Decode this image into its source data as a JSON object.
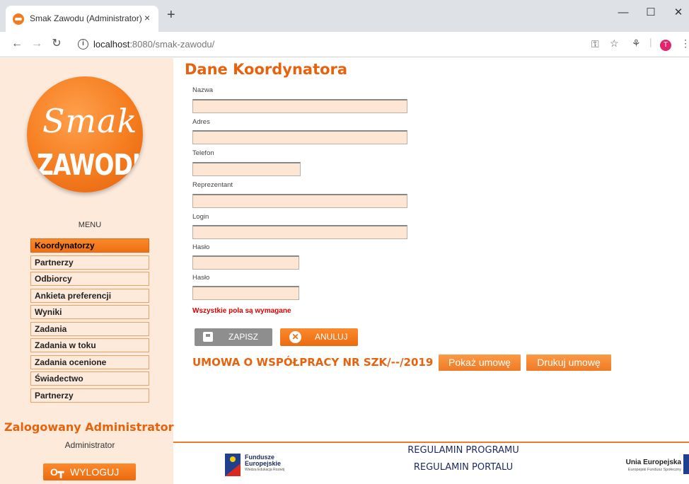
{
  "browser": {
    "tab_title": "Smak Zawodu (Administrator)",
    "tab_close": "×",
    "new_tab": "+",
    "window_min": "—",
    "window_max": "☐",
    "window_close": "✕",
    "url_host": "localhost",
    "url_rest": ":8080/smak-zawodu/",
    "profile_initial": "T"
  },
  "sidebar": {
    "logo_smak": "Smak",
    "logo_zawodu": "ZAWODU",
    "menu_title": "MENU",
    "menu_items": [
      {
        "label": "Koordynatorzy",
        "active": true
      },
      {
        "label": "Partnerzy"
      },
      {
        "label": "Odbiorcy"
      },
      {
        "label": "Ankieta preferencji"
      },
      {
        "label": "Wyniki"
      },
      {
        "label": "Zadania"
      },
      {
        "label": "Zadania w toku"
      },
      {
        "label": "Zadania ocenione"
      },
      {
        "label": "Świadectwo"
      },
      {
        "label": "Partnerzy"
      }
    ],
    "logged_title": "Zalogowany Administrator",
    "logged_user": "Administrator",
    "logout_label": "WYLOGUJ"
  },
  "main": {
    "title": "Dane Koordynatora",
    "fields": [
      {
        "label": "Nazwa",
        "value": ""
      },
      {
        "label": "Adres",
        "value": ""
      },
      {
        "label": "Telefon",
        "value": ""
      },
      {
        "label": "Reprezentant",
        "value": ""
      },
      {
        "label": "Login",
        "value": ""
      },
      {
        "label": "Hasło",
        "value": ""
      },
      {
        "label": "Hasło",
        "value": ""
      }
    ],
    "required_note": "Wszystkie pola są wymagane",
    "save_label": "ZAPISZ",
    "cancel_label": "ANULUJ",
    "contract_text": "UMOWA O WSPÓŁPRACY NR SZK/--/2019",
    "show_contract_label": "Pokaż umowę",
    "print_contract_label": "Drukuj umowę"
  },
  "footer": {
    "fe_line1": "Fundusze",
    "fe_line2": "Europejskie",
    "fe_line3": "Wiedza Edukacja Rozwój",
    "link_program": "REGULAMIN PROGRAMU",
    "link_portal": "REGULAMIN PORTALU",
    "ue_line1": "Unia Europejska",
    "ue_line2": "Europejski Fundusz Społeczny"
  },
  "colors": {
    "accent": "#e8620e",
    "sidebar_bg": "#fdeadb",
    "input_bg": "#fde6d4",
    "required": "#d90000"
  }
}
